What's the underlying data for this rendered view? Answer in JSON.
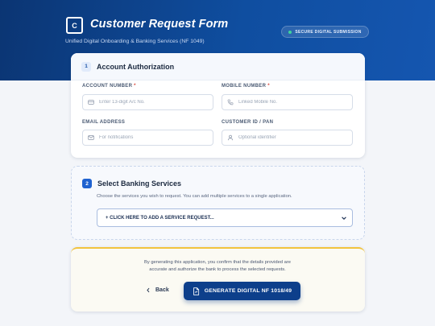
{
  "header": {
    "logo_letter": "C",
    "title": "Customer Request Form",
    "subtitle": "Unified Digital Onboarding & Banking Services (NF 1049)",
    "secure_badge": "SECURE DIGITAL SUBMISSION",
    "brand_color": "#0f4ea0"
  },
  "step1": {
    "number": "1",
    "title": "Account Authorization",
    "fields": {
      "account_number": {
        "label": "ACCOUNT NUMBER",
        "required_mark": "*",
        "placeholder": "Enter 13-digit A/c No.",
        "value": "",
        "icon": "card-icon"
      },
      "mobile_number": {
        "label": "MOBILE NUMBER",
        "required_mark": "*",
        "placeholder": "Linked Mobile No.",
        "value": "",
        "icon": "phone-icon"
      },
      "email": {
        "label": "EMAIL ADDRESS",
        "placeholder": "For notifications",
        "value": "",
        "icon": "mail-icon"
      },
      "customer_id": {
        "label": "CUSTOMER ID / PAN",
        "placeholder": "Optional identifier",
        "value": "",
        "icon": "user-icon"
      }
    }
  },
  "step2": {
    "number": "2",
    "title": "Select Banking Services",
    "help": "Choose the services you wish to request. You can add multiple services to a single application.",
    "select_value": "+ CLICK HERE TO ADD A SERVICE REQUEST..."
  },
  "footer": {
    "confirm_line1": "By generating this application, you confirm that the details provided are",
    "confirm_line2": "accurate and authorize the bank to process the selected requests.",
    "back_label": "Back",
    "generate_label": "GENERATE DIGITAL NF 1018/49",
    "accent_color": "#f2c33d"
  }
}
